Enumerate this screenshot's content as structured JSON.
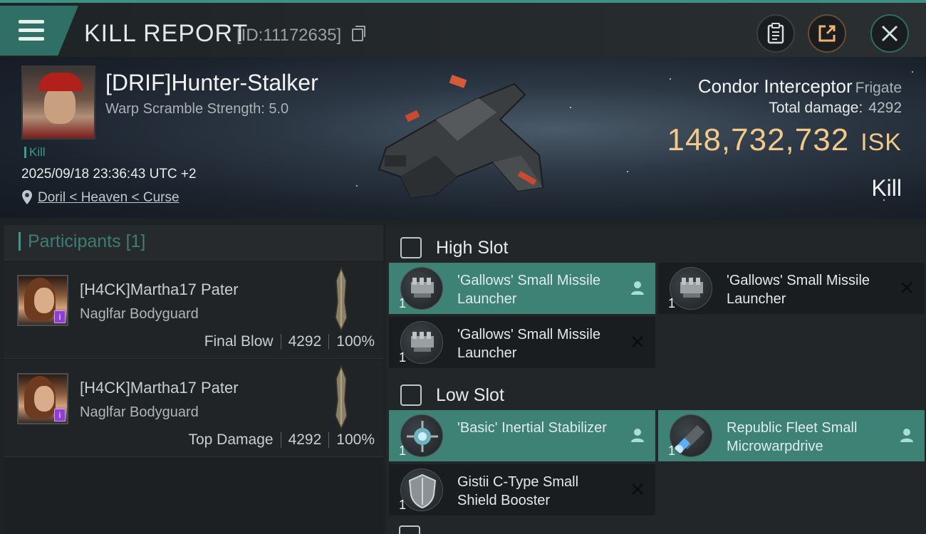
{
  "header": {
    "title": "KILL REPORT",
    "report_id": "[ID:11172635]"
  },
  "victim": {
    "name": "[DRIF]Hunter-Stalker",
    "warp_scramble": "Warp Scramble Strength: 5.0",
    "tag": "Kill",
    "timestamp": "2025/09/18 23:36:43 UTC +2",
    "location": "Doril < Heaven < Curse",
    "ship_name": "Condor Interceptor",
    "ship_class": "Frigate",
    "total_damage_label": "Total damage:",
    "total_damage": "4292",
    "isk_value": "148,732,732",
    "isk_unit": "ISK",
    "result": "Kill"
  },
  "participants": {
    "title": "Participants",
    "count": "[1]",
    "items": [
      {
        "name": "[H4CK]Martha17 Pater",
        "ship": "Naglfar Bodyguard",
        "role": "Final Blow",
        "damage": "4292",
        "percent": "100%"
      },
      {
        "name": "[H4CK]Martha17 Pater",
        "ship": "Naglfar Bodyguard",
        "role": "Top Damage",
        "damage": "4292",
        "percent": "100%"
      }
    ]
  },
  "fitting": {
    "high_slot": {
      "label": "High Slot",
      "modules": [
        {
          "name": "'Gallows' Small Missile Launcher",
          "qty": "1",
          "status": "dropped"
        },
        {
          "name": "'Gallows' Small Missile Launcher",
          "qty": "1",
          "status": "destroyed"
        },
        {
          "name": "'Gallows' Small Missile Launcher",
          "qty": "1",
          "status": "destroyed"
        }
      ]
    },
    "low_slot": {
      "label": "Low Slot",
      "modules": [
        {
          "name": "'Basic' Inertial Stabilizer",
          "qty": "1",
          "status": "dropped"
        },
        {
          "name": "Republic Fleet Small Microwarpdrive",
          "qty": "1",
          "status": "dropped"
        },
        {
          "name": "Gistii C-Type Small Shield Booster",
          "qty": "1",
          "status": "destroyed"
        }
      ]
    }
  },
  "colors": {
    "accent_teal": "#3d8275",
    "isk_gold": "#f3c98a",
    "badge_purple": "#8e3dd6"
  }
}
